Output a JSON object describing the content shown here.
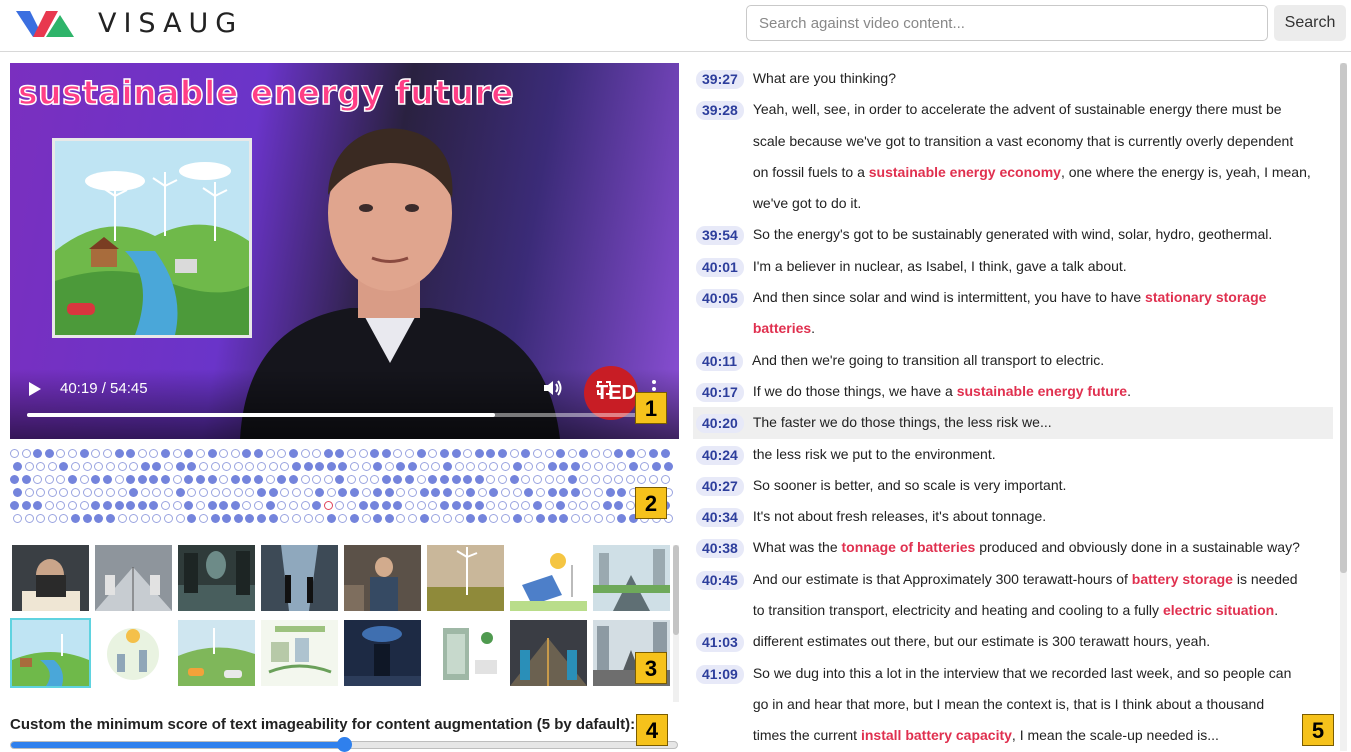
{
  "app": {
    "logo_text": "VISAUG",
    "brand_colors": [
      "#3b6fe0",
      "#e8394f",
      "#2fb46a"
    ]
  },
  "search": {
    "placeholder": "Search against video content...",
    "button_label": "Search"
  },
  "video": {
    "overlay_title": "sustainable energy future",
    "time_display": "40:19 / 54:45",
    "progress_fraction": 0.7366,
    "badge_text": "TED",
    "callout_number": "1"
  },
  "dot_timeline": {
    "callout_number": "2",
    "rows": 6,
    "cols": 57,
    "accent_color": "#5c6fd6",
    "current_color": "#e0435a"
  },
  "thumbnails": {
    "callout_number": "3",
    "selected_index": 8,
    "items": [
      "worried-man-at-desk",
      "factory-production-line",
      "flooded-dark-street",
      "office-corridor-people",
      "worker-in-workshop",
      "wind-turbines-field",
      "solar-panel-illustration",
      "city-highway-skyline",
      "wind-turbines-landscape",
      "renewable-energy-infographic",
      "electric-cars-wind-turbines",
      "energy-process-infographic",
      "workers-in-tunnel",
      "green-building-recycling",
      "battery-factory-assembly",
      "highway-traffic-towers"
    ]
  },
  "slider": {
    "label": "Custom the minimum score of text imageability for content augmentation (5 by dafault):",
    "value": "5",
    "fraction": 0.5,
    "callout_number": "4"
  },
  "transcript": {
    "callout_number": "5",
    "active_index": 7,
    "rows": [
      {
        "time": "39:27",
        "text": [
          {
            "t": "What are you thinking?"
          }
        ]
      },
      {
        "time": "39:28",
        "lines": [
          [
            {
              "t": "Yeah, well, see, in order to accelerate the advent of sustainable energy there must be"
            }
          ],
          [
            {
              "t": "scale because we've got to transition a vast economy that is currently overly dependent"
            }
          ],
          [
            {
              "t": "on fossil fuels to a "
            },
            {
              "t": "sustainable energy economy",
              "hl": true
            },
            {
              "t": ", one where the energy is, yeah, I mean,"
            }
          ],
          [
            {
              "t": "we've got to do it."
            }
          ]
        ]
      },
      {
        "time": "39:54",
        "text": [
          {
            "t": "So the energy's got to be sustainably generated with wind, solar, hydro, geothermal."
          }
        ]
      },
      {
        "time": "40:01",
        "text": [
          {
            "t": "I'm a believer in nuclear, as Isabel, I think, gave a talk about."
          }
        ]
      },
      {
        "time": "40:05",
        "lines": [
          [
            {
              "t": "And then since solar and wind is intermittent, you have to have "
            },
            {
              "t": "stationary storage",
              "hl": true
            }
          ],
          [
            {
              "t": "batteries",
              "hl": true
            },
            {
              "t": "."
            }
          ]
        ]
      },
      {
        "time": "40:11",
        "text": [
          {
            "t": "And then we're going to transition all transport to electric."
          }
        ]
      },
      {
        "time": "40:17",
        "text": [
          {
            "t": "If we do those things, we have a "
          },
          {
            "t": "sustainable energy future",
            "hl": true
          },
          {
            "t": "."
          }
        ]
      },
      {
        "time": "40:20",
        "text": [
          {
            "t": "The faster we do those things, the less risk we..."
          }
        ]
      },
      {
        "time": "40:24",
        "text": [
          {
            "t": "the less risk we put to the environment."
          }
        ]
      },
      {
        "time": "40:27",
        "text": [
          {
            "t": "So sooner is better, and so scale is very important."
          }
        ]
      },
      {
        "time": "40:34",
        "text": [
          {
            "t": "It's not about fresh releases, it's about tonnage."
          }
        ]
      },
      {
        "time": "40:38",
        "text": [
          {
            "t": "What was the "
          },
          {
            "t": "tonnage of batteries",
            "hl": true
          },
          {
            "t": " produced and obviously done in a sustainable way?"
          }
        ]
      },
      {
        "time": "40:45",
        "lines": [
          [
            {
              "t": "And our estimate is that Approximately 300 terawatt-hours of "
            },
            {
              "t": "battery storage",
              "hl": true
            },
            {
              "t": " is needed"
            }
          ],
          [
            {
              "t": "to transition transport, electricity and heating and cooling to a fully "
            },
            {
              "t": "electric situation",
              "hl": true
            },
            {
              "t": "."
            }
          ]
        ]
      },
      {
        "time": "41:03",
        "text": [
          {
            "t": "different estimates out there, but our estimate is 300 terawatt hours, yeah."
          }
        ]
      },
      {
        "time": "41:09",
        "lines": [
          [
            {
              "t": "So we dug into this a lot in the interview that we recorded last week, and so people can"
            }
          ],
          [
            {
              "t": "go in and hear that more, but I mean the context is, that is I think about a thousand"
            }
          ],
          [
            {
              "t": "times the current "
            },
            {
              "t": "install battery capacity",
              "hl": true
            },
            {
              "t": ", I mean the scale-up needed is..."
            }
          ]
        ]
      }
    ]
  }
}
